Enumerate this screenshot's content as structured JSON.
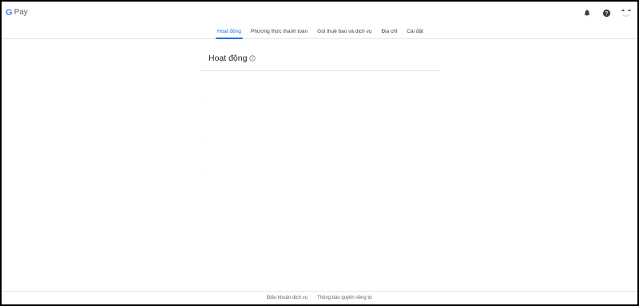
{
  "brand": {
    "logo_letter": "G",
    "product": "Pay"
  },
  "header": {
    "icons": [
      "bell-icon",
      "help-icon",
      "avatar"
    ]
  },
  "tabs": [
    {
      "label": "Hoạt động",
      "active": true
    },
    {
      "label": "Phương thức thanh toán",
      "active": false
    },
    {
      "label": "Gói thuê bao và dịch vụ",
      "active": false
    },
    {
      "label": "Địa chỉ",
      "active": false
    },
    {
      "label": "Cài đặt",
      "active": false
    }
  ],
  "main": {
    "title": "Hoạt động"
  },
  "footer": {
    "terms": "Điều khoản dịch vụ",
    "privacy": "Thông báo quyền riêng tư"
  },
  "colors": {
    "accent": "#1a73e8",
    "text": "#202124",
    "muted": "#5f6368"
  }
}
